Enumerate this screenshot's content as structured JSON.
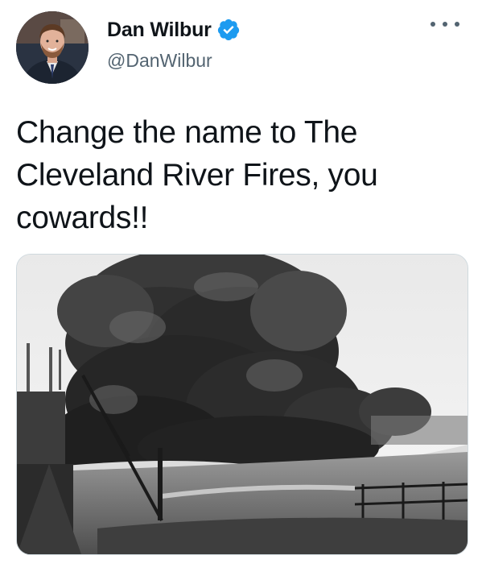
{
  "author": {
    "display_name": "Dan Wilbur",
    "handle": "@DanWilbur",
    "verified_icon": "verified-badge-icon",
    "avatar_icon": "profile-photo"
  },
  "tweet": {
    "text": "Change the name to The\nCleveland River Fires, you\ncowards!!"
  },
  "media": {
    "kind": "black-and-white photograph",
    "subject": "smoke from a river fire"
  },
  "menu": {
    "icon": "more-options-icon"
  },
  "colors": {
    "text": "#0f1419",
    "secondary": "#536471",
    "verified": "#1d9bf0",
    "border": "#cfd9de"
  }
}
